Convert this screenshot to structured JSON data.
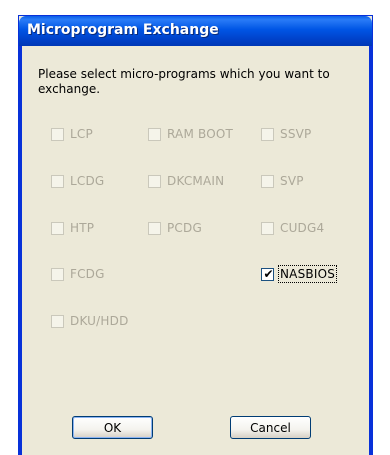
{
  "window": {
    "title": "Microprogram Exchange"
  },
  "prompt": "Please select micro-programs which you want to exchange.",
  "checkboxes": {
    "lcp": {
      "label": "LCP",
      "checked": false,
      "enabled": false
    },
    "rambOOT": {
      "label": "RAM BOOT",
      "checked": false,
      "enabled": false
    },
    "ssvp": {
      "label": "SSVP",
      "checked": false,
      "enabled": false
    },
    "lcdg": {
      "label": "LCDG",
      "checked": false,
      "enabled": false
    },
    "dkcmain": {
      "label": "DKCMAIN",
      "checked": false,
      "enabled": false
    },
    "svp": {
      "label": "SVP",
      "checked": false,
      "enabled": false
    },
    "htp": {
      "label": "HTP",
      "checked": false,
      "enabled": false
    },
    "pcdg": {
      "label": "PCDG",
      "checked": false,
      "enabled": false
    },
    "cudg4": {
      "label": "CUDG4",
      "checked": false,
      "enabled": false
    },
    "fcdg": {
      "label": "FCDG",
      "checked": false,
      "enabled": false
    },
    "nasbios": {
      "label": "NASBIOS",
      "checked": true,
      "enabled": true
    },
    "dkuhdd": {
      "label": "DKU/HDD",
      "checked": false,
      "enabled": false
    }
  },
  "buttons": {
    "ok": "OK",
    "cancel": "Cancel"
  },
  "colors": {
    "titlebar": "#0055e5",
    "dialog_bg": "#ece9d8",
    "disabled_text": "#aca899"
  }
}
